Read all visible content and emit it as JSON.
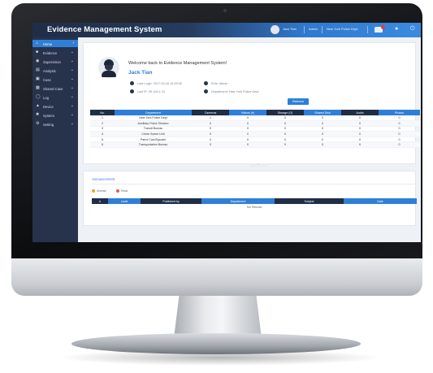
{
  "app": {
    "title": "Evidence Management System"
  },
  "topbar": {
    "user_name": "Jack Tian",
    "items": [
      "Admin",
      "New York Police Dept"
    ],
    "icons": [
      "bell-icon",
      "user-icon",
      "power-icon"
    ],
    "notification_color": "#e33d3d"
  },
  "sidebar": {
    "items": [
      {
        "label": "Home",
        "icon": "home-icon",
        "active": true
      },
      {
        "label": "Evidence",
        "icon": "evidence-icon"
      },
      {
        "label": "Supervision",
        "icon": "eye-icon"
      },
      {
        "label": "Analysis",
        "icon": "chart-icon"
      },
      {
        "label": "Case",
        "icon": "case-icon"
      },
      {
        "label": "Shared Case",
        "icon": "share-icon"
      },
      {
        "label": "Log",
        "icon": "log-icon"
      },
      {
        "label": "Device",
        "icon": "device-icon"
      },
      {
        "label": "System",
        "icon": "system-icon"
      },
      {
        "label": "Setting",
        "icon": "gear-icon"
      }
    ]
  },
  "welcome": {
    "message": "Welcome back to Evidence Management System!",
    "name": "Jack Tian",
    "last_login": "Last Login: 2017-03-16 19:25:06",
    "last_ip": "Last IP: 39.109.1.24",
    "role": "Role: Admin",
    "department": "Department: New York Police Dept",
    "refresh_label": "Refresh"
  },
  "stats": {
    "headers": [
      "No.",
      "Department",
      "Cameras",
      "Videos (h)",
      "Storage (G)",
      "Shared Disk",
      "Audio",
      "Photos"
    ],
    "rows": [
      [
        "1",
        "New York Police Dept",
        "1",
        "0",
        "0",
        "0",
        "0",
        "0"
      ],
      [
        "2",
        "Auxiliary Police Division",
        "0",
        "0",
        "0",
        "0",
        "0",
        "0"
      ],
      [
        "3",
        "Transit Bureau",
        "0",
        "0",
        "0",
        "0",
        "0",
        "0"
      ],
      [
        "4",
        "Crime Scene Unit",
        "0",
        "0",
        "0",
        "0",
        "0",
        "0"
      ],
      [
        "5",
        "Patrol Cars/Squads",
        "0",
        "0",
        "0",
        "0",
        "0",
        "0"
      ],
      [
        "6",
        "Transportation Bureau",
        "0",
        "0",
        "0",
        "0",
        "0",
        "0"
      ]
    ]
  },
  "announcement": {
    "title": "Announcement",
    "legend": [
      {
        "label": "Unread",
        "color": "#f0a030"
      },
      {
        "label": "Read",
        "color": "#e05c5c"
      }
    ],
    "headers": [
      "#",
      "Level",
      "Published by",
      "Department",
      "Subject",
      "Date"
    ],
    "empty": "No Record"
  }
}
